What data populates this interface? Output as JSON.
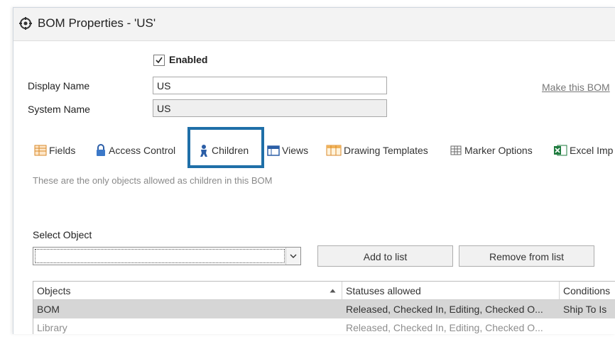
{
  "window": {
    "title": "BOM Properties - 'US'"
  },
  "form": {
    "enabled_label": "Enabled",
    "enabled_checked": true,
    "display_name_label": "Display Name",
    "display_name_value": "US",
    "system_name_label": "System Name",
    "system_name_value": "US",
    "make_default_link": "Make this BOM"
  },
  "tabs": [
    {
      "label": "Fields",
      "icon": "fields-grid-icon"
    },
    {
      "label": "Access Control",
      "icon": "lock-icon"
    },
    {
      "label": "Children",
      "icon": "person-icon",
      "selected": true
    },
    {
      "label": "Views",
      "icon": "window-icon"
    },
    {
      "label": "Drawing Templates",
      "icon": "table-template-icon"
    },
    {
      "label": "Marker Options",
      "icon": "marker-grid-icon"
    },
    {
      "label": "Excel Imp",
      "icon": "excel-icon"
    }
  ],
  "children_tab": {
    "hint": "These are the only objects allowed as children in this BOM",
    "select_object_label": "Select Object",
    "select_object_value": "",
    "add_button": "Add to list",
    "remove_button": "Remove from list"
  },
  "grid": {
    "columns": [
      "Objects",
      "Statuses allowed",
      "Conditions"
    ],
    "rows": [
      {
        "object": "BOM",
        "statuses": "Released, Checked In, Editing, Checked O...",
        "conditions": "Ship To Is",
        "selected": true
      },
      {
        "object": "Library",
        "statuses": "Released, Checked In, Editing, Checked O...",
        "conditions": "",
        "selected": false
      }
    ]
  },
  "colors": {
    "highlight_box": "#1f6fa8",
    "selected_row": "#d6d6d6",
    "title_bar": "#f3f3f3"
  }
}
